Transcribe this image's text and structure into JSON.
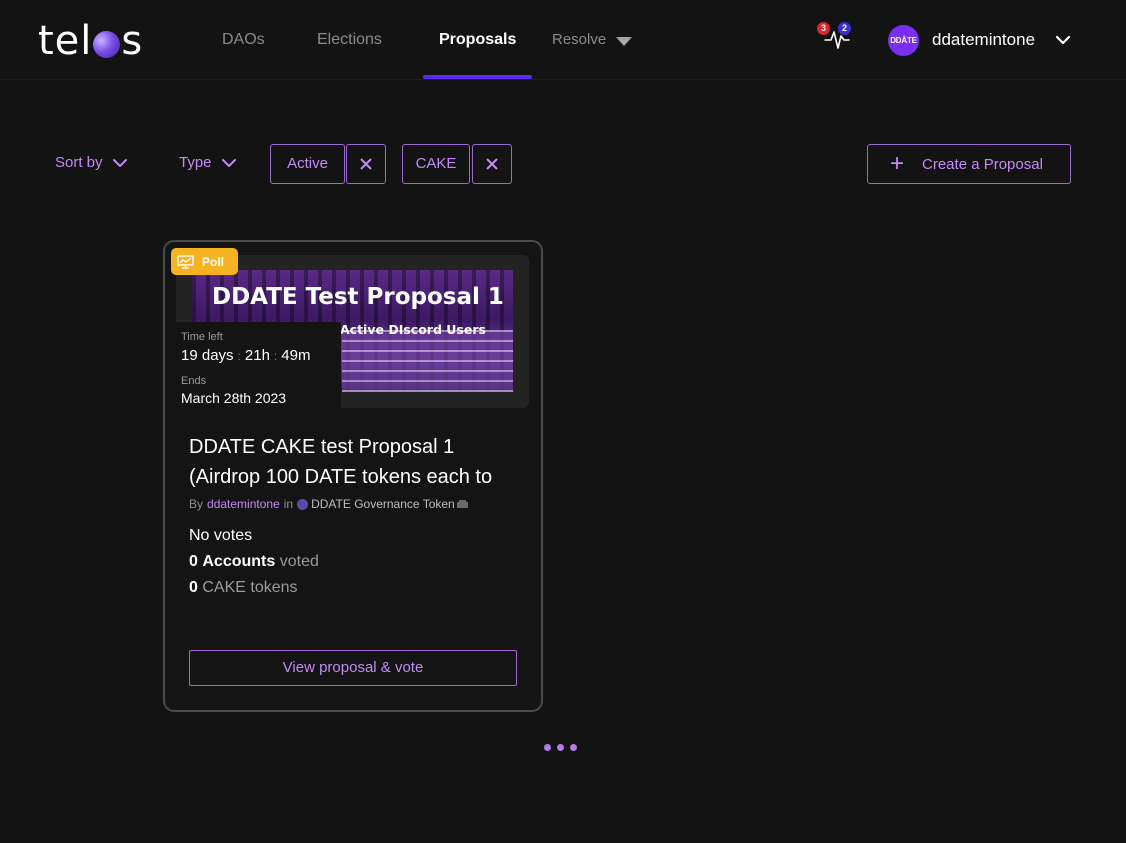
{
  "header": {
    "logo_text_left": "tel",
    "logo_text_right": "s",
    "nav": [
      {
        "label": "DAOs"
      },
      {
        "label": "Elections"
      },
      {
        "label": "Proposals"
      },
      {
        "label": "Resolve"
      }
    ],
    "active_nav": "Proposals",
    "notifications": {
      "red_count": "3",
      "blue_count": "2"
    },
    "user": {
      "avatar_text": "DDÅTE",
      "name": "ddatemintone"
    }
  },
  "filters": {
    "sort_label": "Sort by",
    "type_label": "Type",
    "chips": [
      {
        "label": "Active"
      },
      {
        "label": "CAKE"
      }
    ],
    "create_label": "Create a Proposal"
  },
  "card": {
    "type_badge": "Poll",
    "banner_title": "DDATE Test Proposal 1",
    "banner_subtitle": "Active DIscord Users",
    "time_left_label": "Time left",
    "time_left": {
      "days": "19 days",
      "hours": "21h",
      "minutes": "49m"
    },
    "ends_label": "Ends",
    "ends_value": "March 28th 2023",
    "title_line1": "DDATE CAKE test Proposal 1",
    "title_line2": "(Airdrop 100 DATE tokens each to",
    "by_label": "By",
    "author": "ddatemintone",
    "in_label": "in",
    "dao_name": "DDATE Governance Token",
    "votes_text": "No votes",
    "accounts_count": "0",
    "accounts_label": "Accounts",
    "voted_label": "voted",
    "tokens_count": "0",
    "tokens_label": "CAKE tokens",
    "view_button": "View proposal & vote"
  },
  "colors": {
    "accent": "#c58af6",
    "nav_underline": "#5a2cf0",
    "poll_badge": "#f5b322",
    "background": "#131313"
  }
}
